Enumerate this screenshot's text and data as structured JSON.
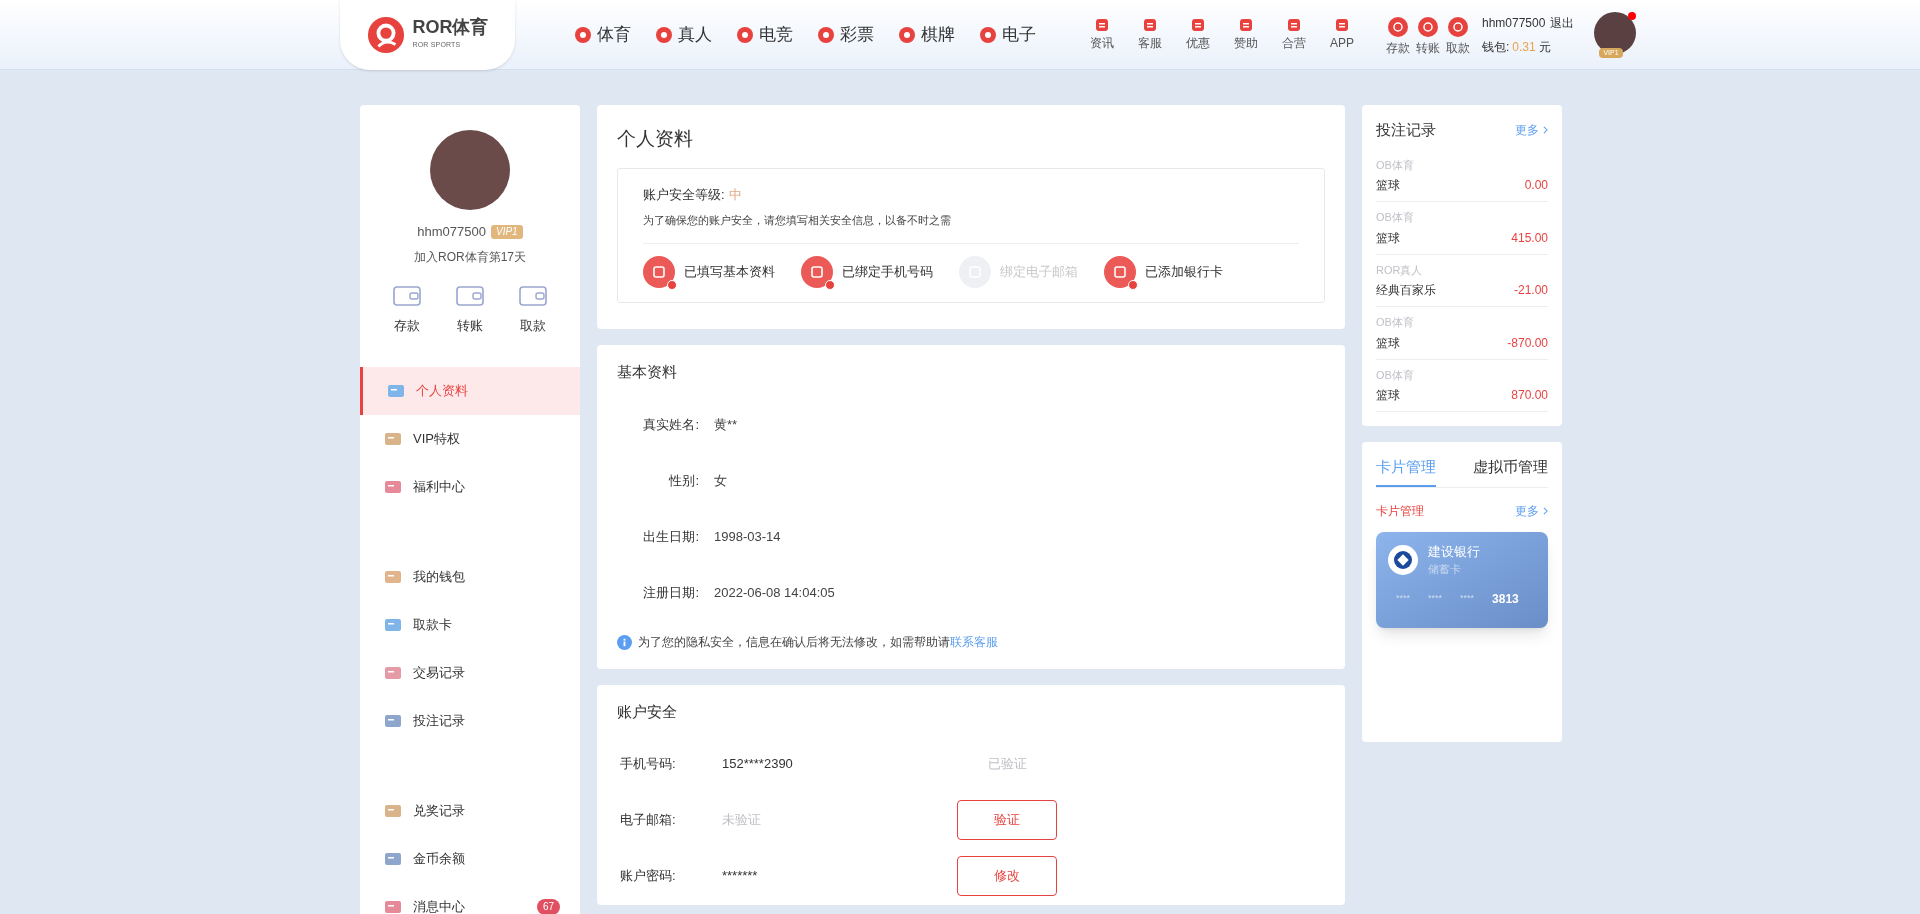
{
  "header": {
    "logo": {
      "title": "ROR体育",
      "subtitle": "ROR SPORTS"
    },
    "nav": [
      {
        "label": "体育"
      },
      {
        "label": "真人"
      },
      {
        "label": "电竞"
      },
      {
        "label": "彩票"
      },
      {
        "label": "棋牌"
      },
      {
        "label": "电子"
      }
    ],
    "tools": [
      {
        "label": "资讯"
      },
      {
        "label": "客服"
      },
      {
        "label": "优惠"
      },
      {
        "label": "赞助"
      },
      {
        "label": "合营"
      },
      {
        "label": "APP"
      }
    ],
    "wallet_actions": [
      {
        "label": "存款"
      },
      {
        "label": "转账"
      },
      {
        "label": "取款"
      }
    ],
    "user": {
      "name": "hhm077500",
      "logout": "退出",
      "wallet_label": "钱包:",
      "wallet_amount": "0.31",
      "wallet_unit": "元",
      "vip": "VIP1",
      "notification": true
    }
  },
  "sidebar": {
    "username": "hhm077500",
    "vip": "VIP1",
    "joined": "加入ROR体育第17天",
    "actions": [
      {
        "label": "存款"
      },
      {
        "label": "转账"
      },
      {
        "label": "取款"
      }
    ],
    "menu_groups": [
      [
        {
          "label": "个人资料",
          "selected": true
        },
        {
          "label": "VIP特权",
          "selected": false
        },
        {
          "label": "福利中心",
          "selected": false
        }
      ],
      [
        {
          "label": "我的钱包",
          "selected": false
        },
        {
          "label": "取款卡",
          "selected": false
        },
        {
          "label": "交易记录",
          "selected": false
        },
        {
          "label": "投注记录",
          "selected": false
        }
      ],
      [
        {
          "label": "兑奖记录",
          "selected": false
        },
        {
          "label": "金币余额",
          "selected": false
        },
        {
          "label": "消息中心",
          "selected": false,
          "badge": "67"
        }
      ]
    ]
  },
  "profile": {
    "title": "个人资料",
    "security_label": "账户安全等级:",
    "security_level": "中",
    "security_note": "为了确保您的账户安全，请您填写相关安全信息，以备不时之需",
    "checks": [
      {
        "label": "已填写基本资料",
        "done": true
      },
      {
        "label": "已绑定手机号码",
        "done": true
      },
      {
        "label": "绑定电子邮箱",
        "done": false
      },
      {
        "label": "已添加银行卡",
        "done": true
      }
    ]
  },
  "basic_info": {
    "title": "基本资料",
    "fields": [
      {
        "label": "真实姓名:",
        "value": "黄**"
      },
      {
        "label": "性别:",
        "value": "女"
      },
      {
        "label": "出生日期:",
        "value": "1998-03-14"
      },
      {
        "label": "注册日期:",
        "value": "2022-06-08 14:04:05"
      }
    ],
    "note": "为了您的隐私安全，信息在确认后将无法修改，如需帮助请",
    "note_link": "联系客服"
  },
  "account_security": {
    "title": "账户安全",
    "rows": [
      {
        "label": "手机号码:",
        "value": "152****2390",
        "muted": false,
        "status": "已验证"
      },
      {
        "label": "电子邮箱:",
        "value": "未验证",
        "muted": true,
        "button": "验证"
      },
      {
        "label": "账户密码:",
        "value": "*******",
        "muted": false,
        "button": "修改"
      }
    ]
  },
  "bets": {
    "title": "投注记录",
    "more": "更多",
    "items": [
      {
        "platform": "OB体育",
        "game": "篮球",
        "amount": "0.00"
      },
      {
        "platform": "OB体育",
        "game": "篮球",
        "amount": "415.00"
      },
      {
        "platform": "ROR真人",
        "game": "经典百家乐",
        "amount": "-21.00"
      },
      {
        "platform": "OB体育",
        "game": "篮球",
        "amount": "-870.00"
      },
      {
        "platform": "OB体育",
        "game": "篮球",
        "amount": "870.00"
      }
    ]
  },
  "cards": {
    "tabs": [
      {
        "label": "卡片管理",
        "selected": true
      },
      {
        "label": "虚拟币管理",
        "selected": false
      }
    ],
    "subtitle": "卡片管理",
    "more": "更多",
    "bank": {
      "name": "建设银行",
      "type": "储蓄卡",
      "masks": [
        "****",
        "****",
        "****"
      ],
      "last4": "3813"
    }
  }
}
